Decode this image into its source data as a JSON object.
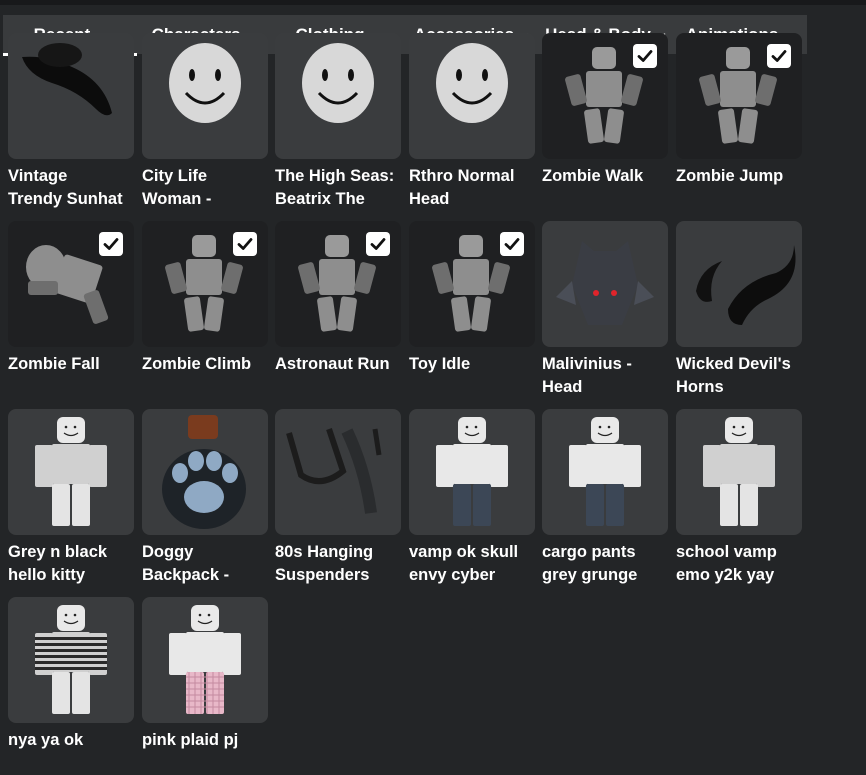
{
  "tabs": [
    {
      "label": "Recent",
      "active": true
    },
    {
      "label": "Characters",
      "active": false
    },
    {
      "label": "Clothing",
      "active": false
    },
    {
      "label": "Accessories",
      "active": false
    },
    {
      "label": "Head & Body",
      "active": false
    },
    {
      "label": "Animations",
      "active": false
    }
  ],
  "items": [
    {
      "name_line1": "Vintage",
      "name_line2": "Trendy Sunhat",
      "icon": "cowboy-hat-icon",
      "checked": false,
      "dark": false
    },
    {
      "name_line1": "City Life",
      "name_line2": "Woman -",
      "icon": "head-icon",
      "checked": false,
      "dark": false
    },
    {
      "name_line1": "The High Seas:",
      "name_line2": "Beatrix The",
      "icon": "head-icon",
      "checked": false,
      "dark": false
    },
    {
      "name_line1": "Rthro Normal",
      "name_line2": "Head",
      "icon": "head-icon",
      "checked": false,
      "dark": false
    },
    {
      "name_line1": "Zombie Walk",
      "name_line2": "",
      "icon": "avatar-icon",
      "checked": true,
      "dark": true
    },
    {
      "name_line1": "Zombie Jump",
      "name_line2": "",
      "icon": "avatar-icon",
      "checked": true,
      "dark": true
    },
    {
      "name_line1": "Zombie Fall",
      "name_line2": "",
      "icon": "avatar-icon",
      "checked": true,
      "dark": true
    },
    {
      "name_line1": "Zombie Climb",
      "name_line2": "",
      "icon": "avatar-icon",
      "checked": true,
      "dark": true
    },
    {
      "name_line1": "Astronaut Run",
      "name_line2": "",
      "icon": "avatar-icon",
      "checked": true,
      "dark": true
    },
    {
      "name_line1": "Toy Idle",
      "name_line2": "",
      "icon": "avatar-icon",
      "checked": true,
      "dark": true
    },
    {
      "name_line1": "Malivinius -",
      "name_line2": "Head",
      "icon": "helmet-icon",
      "checked": false,
      "dark": false
    },
    {
      "name_line1": "Wicked Devil's",
      "name_line2": "Horns",
      "icon": "horns-icon",
      "checked": false,
      "dark": false
    },
    {
      "name_line1": "Grey n black",
      "name_line2": "hello kitty",
      "icon": "shirt-avatar-icon",
      "checked": false,
      "dark": false
    },
    {
      "name_line1": "Doggy",
      "name_line2": "Backpack -",
      "icon": "paw-backpack-icon",
      "checked": false,
      "dark": false
    },
    {
      "name_line1": "80s Hanging",
      "name_line2": "Suspenders",
      "icon": "suspenders-icon",
      "checked": false,
      "dark": false
    },
    {
      "name_line1": "vamp ok skull",
      "name_line2": "envy cyber",
      "icon": "pants-avatar-icon",
      "checked": false,
      "dark": false
    },
    {
      "name_line1": "cargo pants",
      "name_line2": "grey grunge",
      "icon": "pants-avatar-icon",
      "checked": false,
      "dark": false
    },
    {
      "name_line1": "school vamp",
      "name_line2": "emo y2k yay",
      "icon": "shirt-avatar-icon",
      "checked": false,
      "dark": false
    },
    {
      "name_line1": "nya ya ok",
      "name_line2": "",
      "icon": "striped-shirt-avatar-icon",
      "checked": false,
      "dark": false
    },
    {
      "name_line1": "pink plaid pj",
      "name_line2": "",
      "icon": "pink-pants-avatar-icon",
      "checked": false,
      "dark": false
    }
  ],
  "colors": {
    "background": "#232527",
    "tabbar": "#393b3d",
    "thumb": "#3a3c3e",
    "thumb_dark": "#1f2022",
    "text": "#ffffff",
    "accent_red": "#e0242b",
    "pink": "#e8b8c8"
  }
}
